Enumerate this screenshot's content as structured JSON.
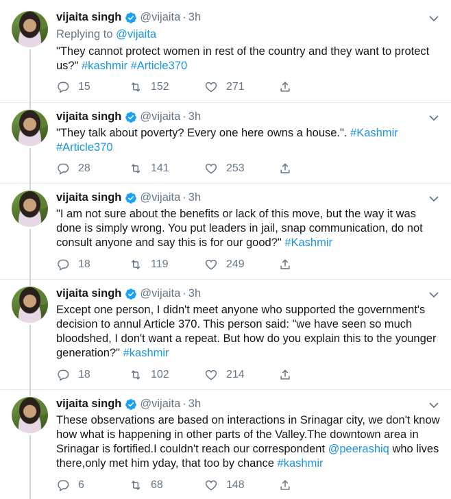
{
  "tweets": [
    {
      "name": "vijaita singh",
      "handle": "@vijaita",
      "sep": "·",
      "time": "3h",
      "replying_prefix": "Replying to",
      "replying_handle": "@vijaita",
      "text_parts": [
        "\"They cannot protect women in rest of the country and they want to protect us?\" ",
        "#kashmir",
        " ",
        "#Article370"
      ],
      "replies": "15",
      "retweets": "152",
      "likes": "271"
    },
    {
      "name": "vijaita singh",
      "handle": "@vijaita",
      "sep": "·",
      "time": "3h",
      "text_parts": [
        "\"They talk about poverty? Every one here owns a house.\". ",
        "#Kashmir",
        " ",
        "#Article370"
      ],
      "replies": "28",
      "retweets": "141",
      "likes": "253"
    },
    {
      "name": "vijaita singh",
      "handle": "@vijaita",
      "sep": "·",
      "time": "3h",
      "text_parts": [
        "\"I am not sure about the benefits or lack of this move, but the way it was done is simply wrong. You put leaders in jail, snap communication, do not consult anyone and say this is for our good?\" ",
        "#Kashmir"
      ],
      "replies": "18",
      "retweets": "119",
      "likes": "249"
    },
    {
      "name": "vijaita singh",
      "handle": "@vijaita",
      "sep": "·",
      "time": "3h",
      "text_parts": [
        "Except one person, I didn't meet anyone who supported the government's decision to annul Article 370. This person said: \"we have seen so much bloodshed, I don't want a repeat. But how do you explain this to the younger generation?\" ",
        "#kashmir"
      ],
      "replies": "18",
      "retweets": "102",
      "likes": "214"
    },
    {
      "name": "vijaita singh",
      "handle": "@vijaita",
      "sep": "·",
      "time": "3h",
      "text_parts": [
        "These observations are based on interactions in Srinagar city, we don't know how what is happening in other parts of the Valley.The downtown area in Srinagar is fortified.I couldn't reach our correspondent ",
        "@peerashiq",
        " who lives there,only met him yday, that too by chance ",
        "#kashmir"
      ],
      "replies": "6",
      "retweets": "68",
      "likes": "148"
    }
  ],
  "icons": {
    "reply": "reply-icon",
    "retweet": "retweet-icon",
    "like": "like-icon",
    "share": "share-icon",
    "verified": "verified-badge-icon",
    "caret": "chevron-down-icon"
  },
  "colors": {
    "link": "#1b95e0",
    "muted": "#657786",
    "text": "#14171a",
    "thread_line": "#ccd6dd",
    "verified": "#1da1f2"
  }
}
